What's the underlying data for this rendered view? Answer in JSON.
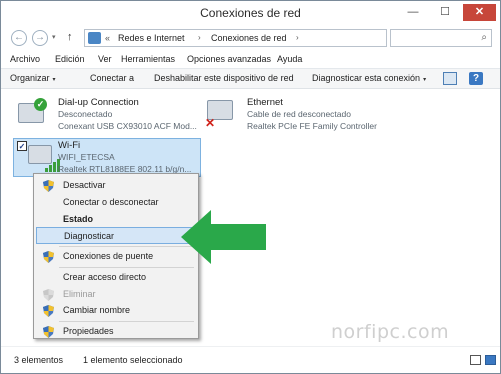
{
  "window": {
    "title": "Conexiones de red",
    "min": "—",
    "max": "☐",
    "close": "✕"
  },
  "nav": {
    "back": "←",
    "forward": "→",
    "dropdown": "▾",
    "up": "↑"
  },
  "address": {
    "chevron": "«",
    "crumbs": [
      "Redes e Internet",
      "Conexiones de red"
    ],
    "separator": "›",
    "dropdown": "▾",
    "refresh": "↻",
    "search_placeholder": "",
    "search_icon": "⌕"
  },
  "menu": [
    "Archivo",
    "Edición",
    "Ver",
    "Herramientas",
    "Opciones avanzadas",
    "Ayuda"
  ],
  "commands": {
    "organize": "Organizar",
    "connect": "Conectar a",
    "disable": "Deshabilitar este dispositivo de red",
    "diagnose": "Diagnosticar esta conexión",
    "arrow": "▾",
    "help": "?"
  },
  "connections": [
    {
      "name": "Dial-up Connection",
      "status": "Desconectado",
      "device": "Conexant USB CX93010 ACF Mod..."
    },
    {
      "name": "Ethernet",
      "status": "Cable de red desconectado",
      "device": "Realtek PCIe FE Family Controller"
    },
    {
      "name": "Wi-Fi",
      "status": "WIFI_ETECSA",
      "device": "Realtek RTL8188EE 802.11 b/g/n..."
    }
  ],
  "icons": {
    "ok_badge": "✓",
    "error_badge": "✕",
    "checkbox_mark": "✓"
  },
  "context_menu": {
    "items": [
      {
        "label": "Desactivar"
      },
      {
        "label": "Conectar o desconectar"
      },
      {
        "label": "Estado"
      },
      {
        "label": "Diagnosticar"
      },
      {
        "label": "Conexiones de puente"
      },
      {
        "label": "Crear acceso directo"
      },
      {
        "label": "Eliminar"
      },
      {
        "label": "Cambiar nombre"
      },
      {
        "label": "Propiedades"
      }
    ]
  },
  "watermark": "norfipc.com",
  "status": {
    "count": "3 elementos",
    "selected": "1 elemento seleccionado"
  },
  "colors": {
    "accent": "#3a78c2",
    "highlight": "#cde4f7",
    "arrow": "#2aa84a",
    "close": "#c7463a"
  }
}
